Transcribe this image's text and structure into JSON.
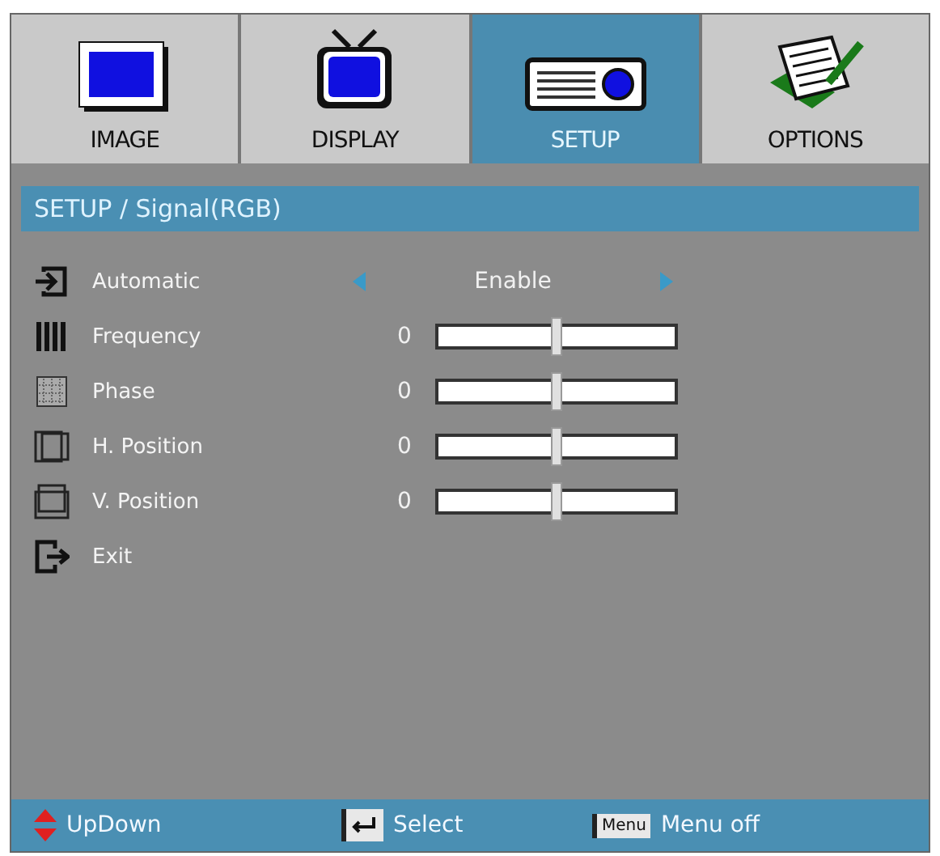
{
  "tabs": [
    {
      "label": "IMAGE",
      "selected": false
    },
    {
      "label": "DISPLAY",
      "selected": false
    },
    {
      "label": "SETUP",
      "selected": true
    },
    {
      "label": "OPTIONS",
      "selected": false
    }
  ],
  "breadcrumb": "SETUP / Signal(RGB)",
  "rows": [
    {
      "kind": "option",
      "label": "Automatic",
      "value": "Enable"
    },
    {
      "kind": "slider",
      "label": "Frequency",
      "reading": "0",
      "level": 0.5
    },
    {
      "kind": "slider",
      "label": "Phase",
      "reading": "0",
      "level": 0.5
    },
    {
      "kind": "slider",
      "label": "H. Position",
      "reading": "0",
      "level": 0.5
    },
    {
      "kind": "slider",
      "label": "V. Position",
      "reading": "0",
      "level": 0.5
    },
    {
      "kind": "action",
      "label": "Exit"
    }
  ],
  "footer": [
    {
      "kind": "updown",
      "label": "UpDown"
    },
    {
      "kind": "enter",
      "label": "Select"
    },
    {
      "kind": "keycap",
      "key": "Menu",
      "label": "Menu off"
    }
  ]
}
